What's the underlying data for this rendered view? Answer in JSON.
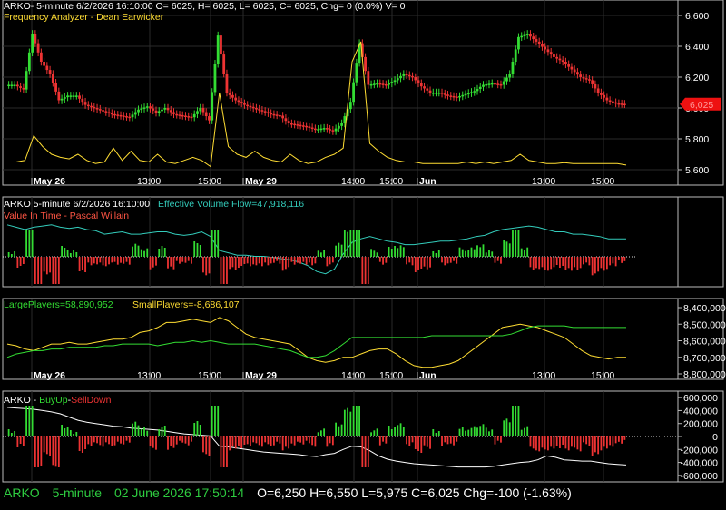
{
  "colors": {
    "up": "#33dd33",
    "down": "#ee3333",
    "price_overlay_up": "#ff6666",
    "yellow": "#ffdd33",
    "cyan": "#33ccbb",
    "white": "#ffffff",
    "grid": "#2a2a2a",
    "price_tag": "#ee1111"
  },
  "panel1": {
    "header": "ARKO- 5-minute 6/2/2026 16:10:00 O= 6025, H= 6025, L= 6025, C= 6025, Chg= 0 (0.0%) V= 0",
    "indicator": "Frequency Analyzer - Dean Earwicker",
    "price_tag": "6,025"
  },
  "panel2": {
    "header_prefix": "ARKO 5-minute  6/2/2026 16:10:00",
    "header_indicator": "Effective Volume Flow=47,918,116",
    "indicator2": "Value In Time - Pascal Willain"
  },
  "panel3": {
    "large": "LargePlayers=58,890,952",
    "small": "SmallPlayers=-8,686,107"
  },
  "panel4": {
    "prefix": "ARKO - ",
    "buy": "BuyUp",
    "sep": "-",
    "sell": "SellDown"
  },
  "status": {
    "symbol": "ARKO",
    "interval": "5-minute",
    "date": "02 June 2026 17:50:14",
    "ohlc": "O=6,250  H=6,550  L=5,975  C=6,025  Chg=-100 (-1.63%)"
  },
  "chart_data": [
    {
      "type": "candlestick",
      "title": "ARKO 5-minute",
      "x_tick_labels": [
        "May 26",
        "13:00",
        "15:00",
        "May 29",
        "14:00",
        "15:00",
        "Jun",
        "13:00",
        "15:00"
      ],
      "y_tick_labels": [
        "6,600",
        "6,400",
        "6,200",
        "6,000",
        "5,800",
        "5,600"
      ],
      "ylim": [
        5500,
        6700
      ],
      "close_path": [
        6150,
        6150,
        6120,
        6480,
        6300,
        6220,
        6050,
        6080,
        6080,
        6020,
        6000,
        5980,
        5960,
        5950,
        5940,
        5990,
        6010,
        5970,
        6000,
        5960,
        5950,
        5940,
        6000,
        5920,
        6470,
        6100,
        6050,
        6020,
        6000,
        5980,
        5960,
        5950,
        5900,
        5890,
        5880,
        5860,
        5870,
        5850,
        5900,
        6040,
        6420,
        6150,
        6160,
        6150,
        6180,
        6220,
        6200,
        6140,
        6100,
        6100,
        6080,
        6070,
        6090,
        6110,
        6150,
        6160,
        6150,
        6220,
        6460,
        6480,
        6430,
        6380,
        6330,
        6300,
        6250,
        6200,
        6180,
        6100,
        6050,
        6030,
        6025
      ],
      "overlay_path": [
        5650,
        5650,
        5660,
        5820,
        5750,
        5700,
        5680,
        5670,
        5700,
        5660,
        5640,
        5650,
        5740,
        5660,
        5720,
        5660,
        5650,
        5700,
        5650,
        5640,
        5660,
        5680,
        5660,
        5620,
        6100,
        5750,
        5700,
        5680,
        5720,
        5680,
        5660,
        5650,
        5700,
        5660,
        5640,
        5650,
        5680,
        5700,
        5740,
        6300,
        6430,
        5770,
        5720,
        5680,
        5660,
        5650,
        5650,
        5640,
        5640,
        5640,
        5640,
        5640,
        5650,
        5640,
        5650,
        5640,
        5650,
        5660,
        5700,
        5660,
        5650,
        5640,
        5640,
        5645,
        5640,
        5640,
        5640,
        5640,
        5640,
        5640,
        5630
      ]
    },
    {
      "type": "line",
      "title": "Effective Volume Flow",
      "series": [
        {
          "name": "Effective Volume Flow",
          "values": [
            0.7,
            0.72,
            0.74,
            0.72,
            0.71,
            0.7,
            0.72,
            0.73,
            0.72,
            0.74,
            0.75,
            0.78,
            0.77,
            0.76,
            0.78,
            0.78,
            0.77,
            0.76,
            0.76,
            0.78,
            0.79,
            0.78,
            0.76,
            0.8,
            0.92,
            0.94,
            0.96,
            0.96,
            0.97,
            0.97,
            0.98,
            0.99,
            1.0,
            1.02,
            1.05,
            1.1,
            1.12,
            1.08,
            0.95,
            0.85,
            0.82,
            0.8,
            0.82,
            0.84,
            0.85,
            0.87,
            0.87,
            0.86,
            0.85,
            0.84,
            0.84,
            0.83,
            0.82,
            0.8,
            0.79,
            0.76,
            0.74,
            0.73,
            0.72,
            0.71,
            0.72,
            0.74,
            0.76,
            0.76,
            0.78,
            0.78,
            0.79,
            0.8,
            0.82,
            0.82,
            0.82
          ]
        }
      ]
    },
    {
      "type": "line",
      "series": [
        {
          "name": "LargePlayers",
          "values": [
            8620000,
            8630000,
            8650000,
            8660000,
            8640000,
            8620000,
            8620000,
            8610000,
            8620000,
            8620000,
            8610000,
            8600000,
            8590000,
            8590000,
            8580000,
            8550000,
            8540000,
            8520000,
            8490000,
            8490000,
            8480000,
            8470000,
            8480000,
            8490000,
            8460000,
            8480000,
            8520000,
            8560000,
            8580000,
            8590000,
            8600000,
            8610000,
            8620000,
            8660000,
            8700000,
            8720000,
            8730000,
            8720000,
            8700000,
            8700000,
            8680000,
            8660000,
            8650000,
            8650000,
            8680000,
            8720000,
            8750000,
            8760000,
            8760000,
            8750000,
            8740000,
            8720000,
            8680000,
            8640000,
            8600000,
            8560000,
            8520000,
            8510000,
            8500000,
            8510000,
            8520000,
            8540000,
            8560000,
            8580000,
            8620000,
            8660000,
            8690000,
            8700000,
            8710000,
            8700000,
            8700000
          ]
        },
        {
          "name": "SmallPlayers",
          "values": [
            8700000,
            8680000,
            8670000,
            8660000,
            8660000,
            8650000,
            8650000,
            8640000,
            8640000,
            8640000,
            8640000,
            8630000,
            8630000,
            8620000,
            8620000,
            8620000,
            8620000,
            8630000,
            8620000,
            8610000,
            8610000,
            8600000,
            8610000,
            8600000,
            8610000,
            8620000,
            8620000,
            8620000,
            8620000,
            8630000,
            8640000,
            8650000,
            8660000,
            8680000,
            8700000,
            8700000,
            8690000,
            8660000,
            8620000,
            8580000,
            8580000,
            8580000,
            8580000,
            8580000,
            8580000,
            8580000,
            8580000,
            8580000,
            8570000,
            8570000,
            8570000,
            8570000,
            8570000,
            8570000,
            8570000,
            8570000,
            8570000,
            8560000,
            8540000,
            8520000,
            8510000,
            8510000,
            8510000,
            8510000,
            8520000,
            8520000,
            8520000,
            8520000,
            8520000,
            8520000,
            8520000
          ]
        }
      ],
      "y_tick_labels": [
        "8,400,000",
        "8,500,000",
        "8,600,000",
        "8,700,000",
        "8,800,000"
      ],
      "ylim": [
        8400000,
        8800000
      ]
    },
    {
      "type": "bar",
      "series": [
        {
          "name": "BuyUp-SellDown",
          "values": [
            450000,
            440000,
            430000,
            420000,
            400000,
            380000,
            350000,
            300000,
            250000,
            220000,
            200000,
            180000,
            160000,
            150000,
            130000,
            120000,
            110000,
            100000,
            80000,
            60000,
            40000,
            30000,
            20000,
            10000,
            -150000,
            -160000,
            -180000,
            -200000,
            -220000,
            -240000,
            -250000,
            -260000,
            -270000,
            -280000,
            -300000,
            -310000,
            -280000,
            -260000,
            -200000,
            -150000,
            -160000,
            -220000,
            -300000,
            -350000,
            -380000,
            -400000,
            -420000,
            -430000,
            -440000,
            -450000,
            -460000,
            -470000,
            -470000,
            -470000,
            -470000,
            -460000,
            -440000,
            -420000,
            -400000,
            -390000,
            -360000,
            -300000,
            -320000,
            -360000,
            -370000,
            -380000,
            -380000,
            -400000,
            -420000,
            -430000,
            -440000
          ]
        }
      ],
      "y_tick_labels": [
        "600,000",
        "400,000",
        "200,000",
        "0",
        "-200,000",
        "-400,000",
        "-600,000"
      ],
      "ylim": [
        -700000,
        700000
      ]
    }
  ]
}
